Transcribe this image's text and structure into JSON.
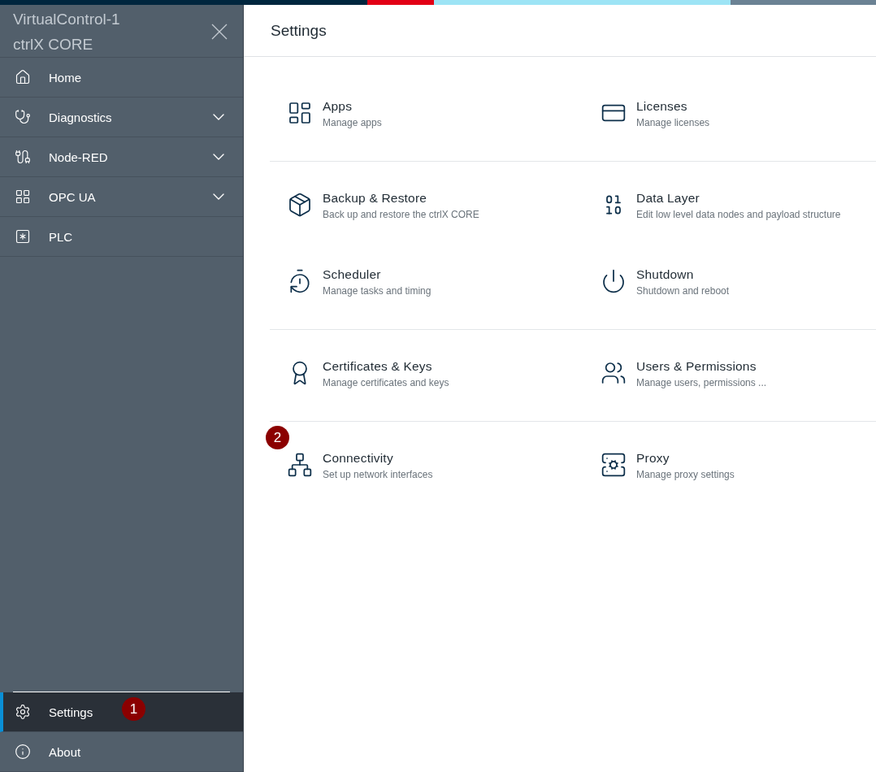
{
  "top_bar_segments": [
    {
      "color": "#00263e"
    },
    {
      "color": "#e20015"
    },
    {
      "color": "#9de4f5"
    },
    {
      "color": "#6b8294"
    }
  ],
  "sidebar": {
    "title": "VirtualControl-1",
    "subtitle": "ctrlX CORE",
    "items": [
      {
        "label": "Home",
        "kind": "home",
        "expandable": false
      },
      {
        "label": "Diagnostics",
        "kind": "stethoscope",
        "expandable": true
      },
      {
        "label": "Node-RED",
        "kind": "node",
        "expandable": true
      },
      {
        "label": "OPC UA",
        "kind": "grid",
        "expandable": true
      },
      {
        "label": "PLC",
        "kind": "plc",
        "expandable": false
      }
    ],
    "bottom_items": [
      {
        "label": "Settings",
        "kind": "gear",
        "selected": true,
        "badge": "1"
      },
      {
        "label": "About",
        "kind": "info",
        "selected": false
      }
    ]
  },
  "page_title": "Settings",
  "groups": [
    {
      "items": [
        {
          "title": "Apps",
          "description": "Manage apps",
          "kind": "apps"
        },
        {
          "title": "Licenses",
          "description": "Manage licenses",
          "kind": "card"
        }
      ]
    },
    {
      "items": [
        {
          "title": "Backup & Restore",
          "description": "Back up and restore the ctrlX CORE",
          "kind": "box"
        },
        {
          "title": "Data Layer",
          "description": "Edit low level data nodes and payload structure",
          "kind": "binary"
        },
        {
          "title": "Scheduler",
          "description": "Manage tasks and timing",
          "kind": "timer"
        },
        {
          "title": "Shutdown",
          "description": "Shutdown and reboot",
          "kind": "power"
        }
      ]
    },
    {
      "items": [
        {
          "title": "Certificates & Keys",
          "description": "Manage certificates and keys",
          "kind": "cert"
        },
        {
          "title": "Users & Permissions",
          "description": "Manage users, permissions ...",
          "kind": "users"
        }
      ]
    },
    {
      "items": [
        {
          "title": "Connectivity",
          "description": "Set up network interfaces",
          "kind": "network",
          "badge": "2"
        },
        {
          "title": "Proxy",
          "description": "Manage proxy settings",
          "kind": "server"
        }
      ]
    }
  ]
}
